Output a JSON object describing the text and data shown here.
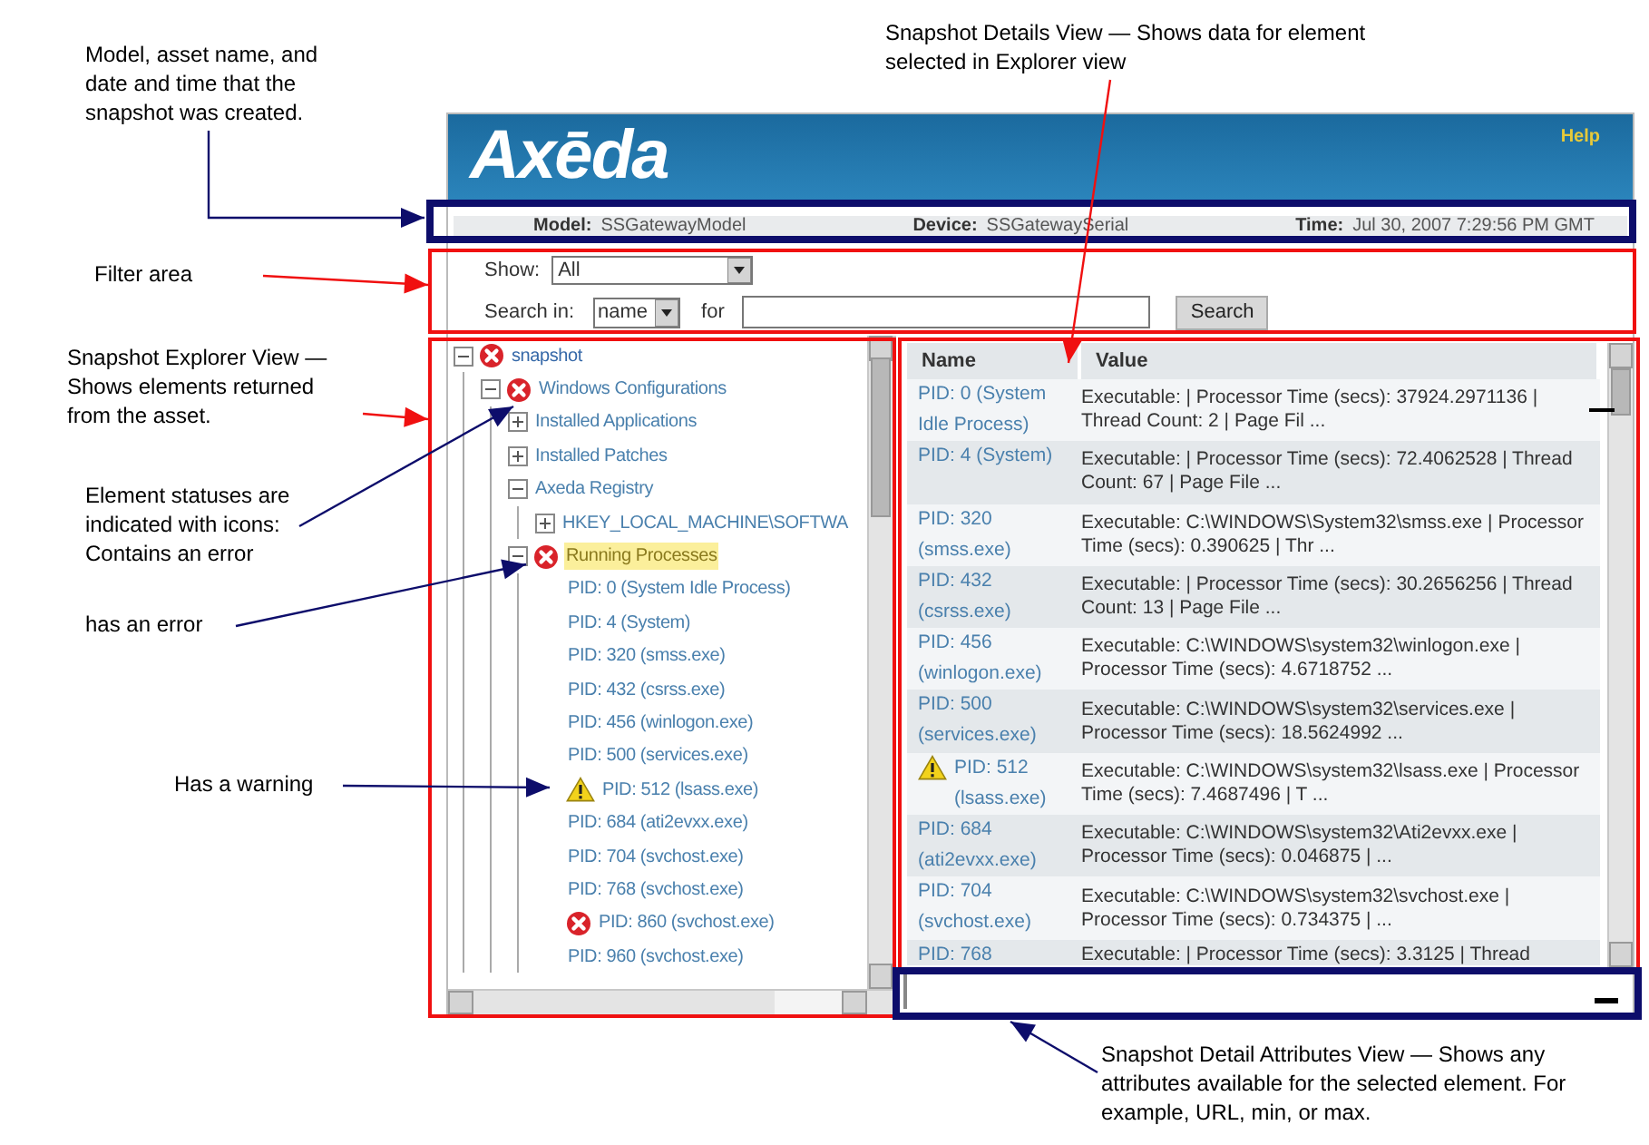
{
  "annotations": [
    {
      "text": "Model, asset name, and date and time that the snapshot was created."
    },
    {
      "text": "Snapshot Details View — Shows data for element selected in Explorer view"
    },
    {
      "text": "Filter area"
    },
    {
      "text": "Snapshot Explorer View — Shows elements returned from the asset."
    },
    {
      "text": "Element statuses are indicated with icons: Contains an error"
    },
    {
      "text": "has an error"
    },
    {
      "text": "Has a warning"
    },
    {
      "text": "Snapshot Detail Attributes View — Shows any attributes available for the selected element. For example, URL, min, or max."
    }
  ],
  "header": {
    "logo": "Axēda",
    "help": "Help"
  },
  "info_bar": [
    {
      "label": "Model:",
      "value": "SSGatewayModel"
    },
    {
      "label": "Device:",
      "value": "SSGatewaySerial"
    },
    {
      "label": "Time:",
      "value": "Jul 30, 2007 7:29:56 PM GMT"
    }
  ],
  "filter": {
    "show_label": "Show:",
    "show_value": "All",
    "search_in_label": "Search in:",
    "search_in_value": "name",
    "for_label": "for",
    "search_button": "Search"
  },
  "tree": [
    {
      "label": "snapshot",
      "error": true,
      "warning": false,
      "expanded": true,
      "selected": false,
      "children": [
        {
          "label": "Windows Configurations",
          "error": true,
          "warning": false,
          "expanded": true,
          "selected": false,
          "children": [
            {
              "label": "Installed Applications",
              "error": false,
              "warning": false,
              "expanded": false,
              "selected": false
            },
            {
              "label": "Installed Patches",
              "error": false,
              "warning": false,
              "expanded": false,
              "selected": false
            },
            {
              "label": "Axeda Registry",
              "error": false,
              "warning": false,
              "expanded": true,
              "selected": false,
              "children": [
                {
                  "label": "HKEY_LOCAL_MACHINE\\SOFTWA",
                  "error": false,
                  "warning": false,
                  "expanded": false,
                  "selected": false
                }
              ]
            },
            {
              "label": "Running Processes",
              "error": true,
              "warning": false,
              "expanded": true,
              "selected": true,
              "children": [
                {
                  "label": "PID: 0 (System Idle Process)",
                  "error": false,
                  "warning": false,
                  "selected": false
                },
                {
                  "label": "PID: 4 (System)",
                  "error": false,
                  "warning": false,
                  "selected": false
                },
                {
                  "label": "PID: 320 (smss.exe)",
                  "error": false,
                  "warning": false,
                  "selected": false
                },
                {
                  "label": "PID: 432 (csrss.exe)",
                  "error": false,
                  "warning": false,
                  "selected": false
                },
                {
                  "label": "PID: 456 (winlogon.exe)",
                  "error": false,
                  "warning": false,
                  "selected": false
                },
                {
                  "label": "PID: 500 (services.exe)",
                  "error": false,
                  "warning": false,
                  "selected": false
                },
                {
                  "label": "PID: 512 (lsass.exe)",
                  "error": false,
                  "warning": true,
                  "selected": false
                },
                {
                  "label": "PID: 684 (ati2evxx.exe)",
                  "error": false,
                  "warning": false,
                  "selected": false
                },
                {
                  "label": "PID: 704 (svchost.exe)",
                  "error": false,
                  "warning": false,
                  "selected": false
                },
                {
                  "label": "PID: 768 (svchost.exe)",
                  "error": false,
                  "warning": false,
                  "selected": false
                },
                {
                  "label": "PID: 860 (svchost.exe)",
                  "error": true,
                  "warning": false,
                  "selected": false
                },
                {
                  "label": "PID: 960 (svchost.exe)",
                  "error": false,
                  "warning": false,
                  "selected": false
                }
              ]
            }
          ]
        }
      ]
    }
  ],
  "details": {
    "columns": [
      "Name",
      "Value"
    ],
    "rows": [
      {
        "name": "PID: 0 (System Idle Process)",
        "warning": false,
        "value": "Executable: | Processor Time (secs): 37924.2971136 | Thread Count: 2 | Page Fil ..."
      },
      {
        "name": "PID: 4 (System)",
        "warning": false,
        "value": "Executable: | Processor Time (secs): 72.4062528 | Thread Count: 67 | Page File ..."
      },
      {
        "name": "PID: 320 (smss.exe)",
        "warning": false,
        "value": "Executable: C:\\WINDOWS\\System32\\smss.exe | Processor Time (secs): 0.390625 | Thr ..."
      },
      {
        "name": "PID: 432 (csrss.exe)",
        "warning": false,
        "value": "Executable: | Processor Time (secs): 30.2656256 | Thread Count: 13 | Page File ..."
      },
      {
        "name": "PID: 456 (winlogon.exe)",
        "warning": false,
        "value": "Executable: C:\\WINDOWS\\system32\\winlogon.exe | Processor Time (secs): 4.6718752 ..."
      },
      {
        "name": "PID: 500 (services.exe)",
        "warning": false,
        "value": "Executable: C:\\WINDOWS\\system32\\services.exe | Processor Time (secs): 18.5624992 ..."
      },
      {
        "name": "PID: 512 (lsass.exe)",
        "warning": true,
        "value": "Executable: C:\\WINDOWS\\system32\\lsass.exe | Processor Time (secs): 7.4687496 | T ..."
      },
      {
        "name": "PID: 684 (ati2evxx.exe)",
        "warning": false,
        "value": "Executable: C:\\WINDOWS\\system32\\Ati2evxx.exe | Processor Time (secs): 0.046875 | ..."
      },
      {
        "name": "PID: 704 (svchost.exe)",
        "warning": false,
        "value": "Executable: C:\\WINDOWS\\system32\\svchost.exe | Processor Time (secs): 0.734375 | ..."
      },
      {
        "name": "PID: 768",
        "warning": false,
        "value": "Executable: | Processor Time (secs): 3.3125 | Thread"
      }
    ]
  }
}
